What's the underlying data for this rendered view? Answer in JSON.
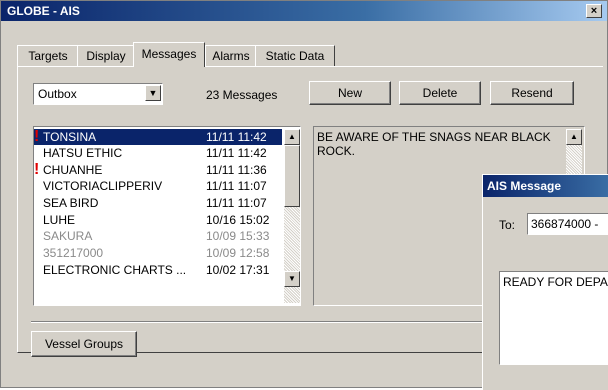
{
  "window": {
    "title": "GLOBE - AIS",
    "close_label": "×"
  },
  "tabs": [
    {
      "label": "Targets",
      "active": false
    },
    {
      "label": "Display",
      "active": false
    },
    {
      "label": "Messages",
      "active": true
    },
    {
      "label": "Alarms",
      "active": false
    },
    {
      "label": "Static Data",
      "active": false
    }
  ],
  "folder": {
    "selected": "Outbox"
  },
  "message_count": "23 Messages",
  "buttons": {
    "new": "New",
    "delete": "Delete",
    "resend": "Resend",
    "vessel_groups": "Vessel Groups"
  },
  "messages": [
    {
      "name": "TONSINA",
      "date": "11/11 11:42",
      "alert": true,
      "selected": true,
      "dim": false
    },
    {
      "name": "HATSU ETHIC",
      "date": "11/11 11:42",
      "alert": false,
      "selected": false,
      "dim": false
    },
    {
      "name": "CHUANHE",
      "date": "11/11 11:36",
      "alert": true,
      "selected": false,
      "dim": false
    },
    {
      "name": "VICTORIACLIPPERIV",
      "date": "11/11 11:07",
      "alert": false,
      "selected": false,
      "dim": false
    },
    {
      "name": "SEA BIRD",
      "date": "11/11 11:07",
      "alert": false,
      "selected": false,
      "dim": false
    },
    {
      "name": "LUHE",
      "date": "10/16 15:02",
      "alert": false,
      "selected": false,
      "dim": false
    },
    {
      "name": "SAKURA",
      "date": "10/09 15:33",
      "alert": false,
      "selected": false,
      "dim": true
    },
    {
      "name": "351217000",
      "date": "10/09 12:58",
      "alert": false,
      "selected": false,
      "dim": true
    },
    {
      "name": "ELECTRONIC CHARTS ...",
      "date": "10/02 17:31",
      "alert": false,
      "selected": false,
      "dim": false
    }
  ],
  "message_body": "BE AWARE OF THE SNAGS NEAR BLACK ROCK.",
  "ais_dialog": {
    "title": "AIS Message",
    "to_label": "To:",
    "to_value": "366874000 -",
    "body": "READY FOR DEPA ISSUES?"
  },
  "colors": {
    "selection": "#0a246a",
    "alert": "#e00000",
    "face": "#d4d0c8"
  }
}
